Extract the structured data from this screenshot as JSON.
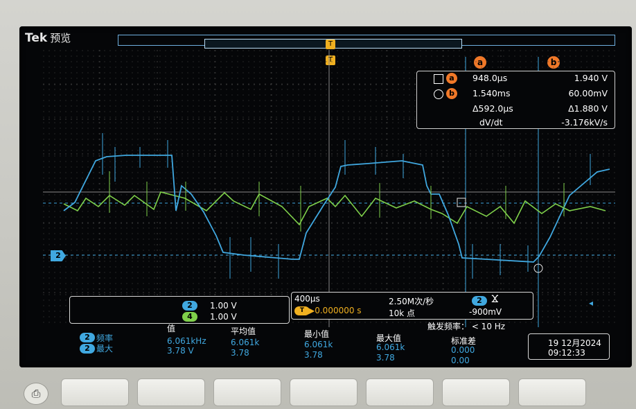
{
  "brand": {
    "name": "Tek",
    "mode": "预览"
  },
  "trigger_marker": "T",
  "cursors": {
    "a_label": "a",
    "b_label": "b"
  },
  "readout": {
    "a_time": "948.0µs",
    "a_value": "1.940 V",
    "b_time": "1.540ms",
    "b_value": "60.00mV",
    "delta_time": "Δ592.0µs",
    "delta_value": "Δ1.880 V",
    "dvdt_label": "dV/dt",
    "dvdt_value": "-3.176kV/s"
  },
  "channel_marker": "2",
  "channels": {
    "ch2": {
      "label": "2",
      "scale": "1.00 V",
      "color": "#40a8e0"
    },
    "ch4": {
      "label": "4",
      "scale": "1.00 V",
      "color": "#7fd04a"
    }
  },
  "timebase": {
    "scale": "400µs",
    "trigger_pos": "▶0.000000 s",
    "sample_rate": "2.50M次/秒",
    "points": "10k 点",
    "trigger_src": "2",
    "trigger_slope": "Ϫ",
    "trigger_level": "-900mV",
    "trigger_freq": "触发频率： < 10 Hz"
  },
  "measurements": {
    "headers": [
      "值",
      "平均值",
      "最小值",
      "最大值",
      "标准差"
    ],
    "rows": [
      {
        "ch": "2",
        "name": "频率",
        "values": [
          "6.061kHz",
          "6.061k",
          "6.061k",
          "6.061k",
          "0.000"
        ]
      },
      {
        "ch": "2",
        "name": "最大",
        "values": [
          "3.78 V",
          "3.78",
          "3.78",
          "3.78",
          "0.00"
        ]
      }
    ]
  },
  "datetime": {
    "date": "19 12月2024",
    "time": "09:12:33"
  },
  "colors": {
    "ch2": "#40a8e0",
    "ch4": "#7fd04a",
    "cursor": "#f07828",
    "trigger": "#f0b020"
  }
}
